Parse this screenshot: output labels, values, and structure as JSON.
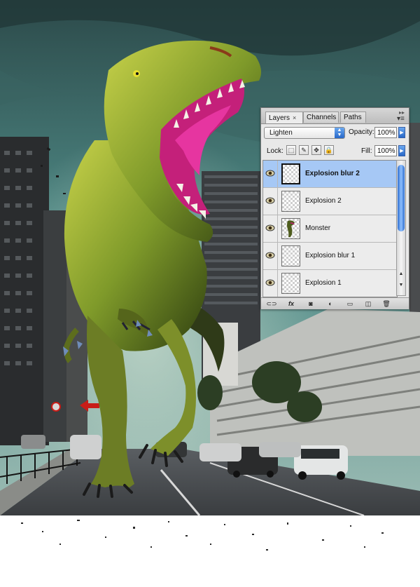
{
  "panel": {
    "tabs": [
      {
        "label": "Layers",
        "active": true
      },
      {
        "label": "Channels",
        "active": false
      },
      {
        "label": "Paths",
        "active": false
      }
    ],
    "tab_close_glyph": "×",
    "blend_mode": "Lighten",
    "opacity_label": "Opacity:",
    "opacity_value": "100%",
    "lock_label": "Lock:",
    "fill_label": "Fill:",
    "fill_value": "100%",
    "layers": [
      {
        "name": "Explosion blur 2",
        "selected": true,
        "visible": true
      },
      {
        "name": "Explosion 2",
        "selected": false,
        "visible": true
      },
      {
        "name": "Monster",
        "selected": false,
        "visible": true
      },
      {
        "name": "Explosion blur 1",
        "selected": false,
        "visible": true
      },
      {
        "name": "Explosion 1",
        "selected": false,
        "visible": true
      }
    ],
    "bottom_buttons": [
      {
        "icon": "link-icon",
        "glyph": "⊂⊃"
      },
      {
        "icon": "fx-icon",
        "glyph": "fx"
      },
      {
        "icon": "mask-icon",
        "glyph": "◙"
      },
      {
        "icon": "adjustment-icon",
        "glyph": "◐"
      },
      {
        "icon": "folder-icon",
        "glyph": "▭"
      },
      {
        "icon": "new-layer-icon",
        "glyph": "◫"
      },
      {
        "icon": "trash-icon",
        "glyph": "🗑"
      }
    ],
    "selection_color": "#a6c8f5",
    "accent_color": "#2868c8"
  }
}
